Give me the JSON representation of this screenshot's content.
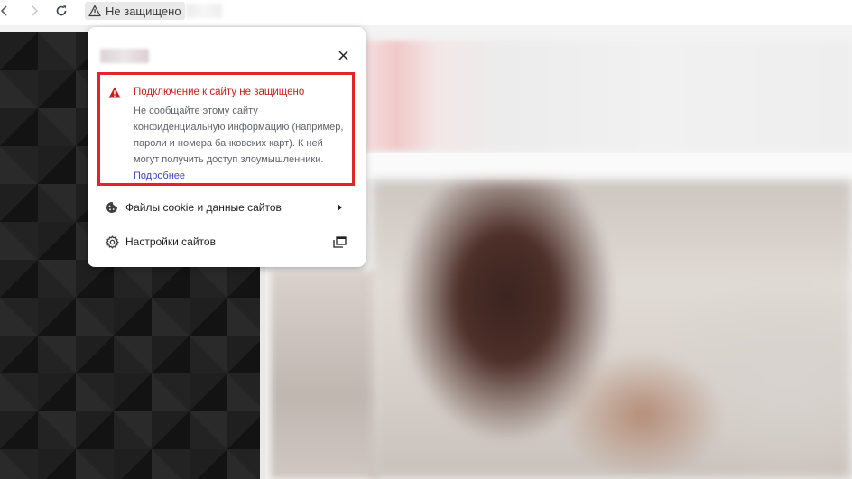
{
  "toolbar": {
    "security_chip_text": "Не защищено"
  },
  "popup": {
    "warning": {
      "title": "Подключение к сайту не защищено",
      "body": "Не сообщайте этому сайту конфиденциальную информацию (например, пароли и номера банковских карт). К ней могут получить доступ злоумышленники. ",
      "link": "Подробнее"
    },
    "menu": {
      "cookies_label": "Файлы cookie и данные сайтов",
      "site_settings_label": "Настройки сайтов"
    }
  },
  "colors": {
    "warning_red": "#e3252a",
    "title_red": "#c5221f",
    "link": "#4040c8"
  }
}
